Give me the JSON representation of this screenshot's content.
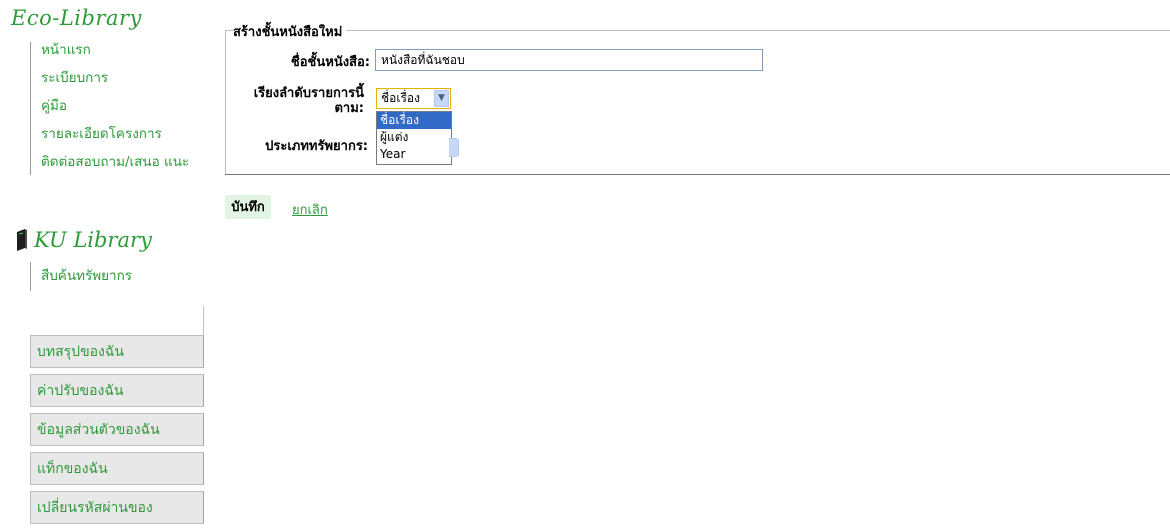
{
  "sidebar": {
    "eco_logo": "Eco-Library",
    "eco_links": [
      "หน้าแรก",
      "ระเบียบการ",
      "คู่มือ",
      "รายละเอียดโครงการ",
      "ติดต่อสอบถาม/เสนอ แนะ"
    ],
    "ku_logo": "KU Library",
    "ku_links": [
      "สืบค้นทรัพยากร"
    ],
    "boxes": [
      "บทสรุปของฉัน",
      "ค่าปรับของฉัน",
      "ข้อมูลส่วนตัวของฉัน",
      "แท็กของฉัน",
      "เปลี่ยนรหัสผ่านของ"
    ]
  },
  "form": {
    "legend": "สร้างชั้นหนังสือใหม่",
    "name_label": "ชื่อชั้นหนังสือ:",
    "name_value": "หนังสือที่ฉันชอบ",
    "sort_label": "เรียงลำดับรายการนี้ ตาม:",
    "sort_selected": "ชื่อเรื่อง",
    "sort_options": [
      "ชื่อเรื่อง",
      "ผู้แต่ง",
      "Year"
    ],
    "type_label": "ประเภททรัพยากร:",
    "save_label": "บันทึก",
    "cancel_label": "ยกเลิก"
  },
  "colors": {
    "brand_green": "#2e9a3a",
    "save_bg": "#e2f4e3",
    "selected_option": "#316ac5",
    "box_bg": "#e8e8e8"
  }
}
